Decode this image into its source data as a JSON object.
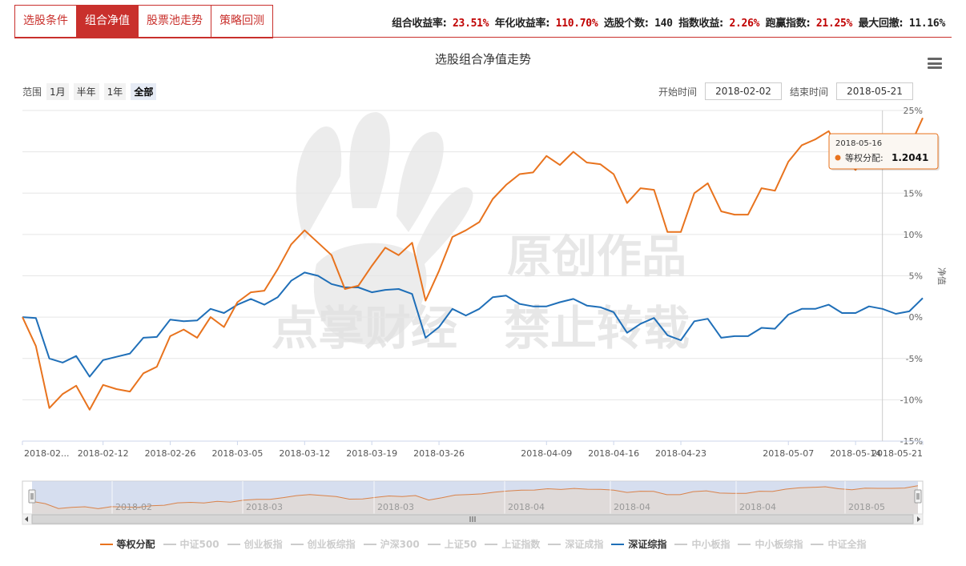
{
  "tabs": [
    {
      "label": "选股条件",
      "active": false
    },
    {
      "label": "组合净值",
      "active": true
    },
    {
      "label": "股票池走势",
      "active": false
    },
    {
      "label": "策略回测",
      "active": false
    }
  ],
  "stats": {
    "combo_return_label": "组合收益率:",
    "combo_return": "23.51%",
    "annual_label": "年化收益率:",
    "annual": "110.70%",
    "count_label": "选股个数:",
    "count": "140",
    "index_return_label": "指数收益:",
    "index_return": "2.26%",
    "beat_label": "跑赢指数:",
    "beat": "21.25%",
    "drawdown_label": "最大回撤:",
    "drawdown": "11.16%"
  },
  "range": {
    "label": "范围",
    "buttons": [
      "1月",
      "半年",
      "1年",
      "全部"
    ],
    "active": "全部"
  },
  "dates": {
    "start_label": "开始时间",
    "start": "2018-02-02",
    "end_label": "结束时间",
    "end": "2018-05-21"
  },
  "tooltip": {
    "date": "2018-05-16",
    "series": "等权分配:",
    "value": "1.2041"
  },
  "watermark": "点掌财经 原创作品 禁止转载",
  "legend": [
    {
      "name": "等权分配",
      "color": "#e8731e",
      "on": true
    },
    {
      "name": "中证500",
      "color": "#cccccc",
      "on": false
    },
    {
      "name": "创业板指",
      "color": "#cccccc",
      "on": false
    },
    {
      "name": "创业板综指",
      "color": "#cccccc",
      "on": false
    },
    {
      "name": "沪深300",
      "color": "#cccccc",
      "on": false
    },
    {
      "name": "上证50",
      "color": "#cccccc",
      "on": false
    },
    {
      "name": "上证指数",
      "color": "#cccccc",
      "on": false
    },
    {
      "name": "深证成指",
      "color": "#cccccc",
      "on": false
    },
    {
      "name": "深证综指",
      "color": "#1f6fb8",
      "on": true
    },
    {
      "name": "中小板指",
      "color": "#cccccc",
      "on": false
    },
    {
      "name": "中小板综指",
      "color": "#cccccc",
      "on": false
    },
    {
      "name": "中证全指",
      "color": "#cccccc",
      "on": false
    }
  ],
  "navigator_labels": [
    "2018-02",
    "2018-03",
    "2018-03",
    "2018-04",
    "2018-04",
    "2018-04",
    "2018-05"
  ],
  "chart_data": {
    "type": "line",
    "title": "选股组合净值走势",
    "ylabel": "净值",
    "ylim": [
      -15,
      25
    ],
    "yticks": [
      "25%",
      "20%",
      "15%",
      "10%",
      "5%",
      "0%",
      "-5%",
      "-10%",
      "-15%"
    ],
    "xticks": [
      "2018-02...",
      "2018-02-12",
      "2018-02-26",
      "2018-03-05",
      "2018-03-12",
      "2018-03-19",
      "2018-03-26",
      "2018-04-09",
      "2018-04-16",
      "2018-04-23",
      "2018-05-07",
      "2018-05-14",
      "2018-05-21"
    ],
    "x": [
      "2018-02-02",
      "2018-02-05",
      "2018-02-06",
      "2018-02-07",
      "2018-02-08",
      "2018-02-09",
      "2018-02-12",
      "2018-02-13",
      "2018-02-14",
      "2018-02-22",
      "2018-02-23",
      "2018-02-26",
      "2018-02-27",
      "2018-02-28",
      "2018-03-01",
      "2018-03-02",
      "2018-03-05",
      "2018-03-06",
      "2018-03-07",
      "2018-03-08",
      "2018-03-09",
      "2018-03-12",
      "2018-03-13",
      "2018-03-14",
      "2018-03-15",
      "2018-03-16",
      "2018-03-19",
      "2018-03-20",
      "2018-03-21",
      "2018-03-22",
      "2018-03-23",
      "2018-03-26",
      "2018-03-27",
      "2018-03-28",
      "2018-03-29",
      "2018-03-30",
      "2018-04-02",
      "2018-04-03",
      "2018-04-04",
      "2018-04-09",
      "2018-04-10",
      "2018-04-11",
      "2018-04-12",
      "2018-04-13",
      "2018-04-16",
      "2018-04-17",
      "2018-04-18",
      "2018-04-19",
      "2018-04-20",
      "2018-04-23",
      "2018-04-24",
      "2018-04-25",
      "2018-04-26",
      "2018-04-27",
      "2018-05-02",
      "2018-05-03",
      "2018-05-04",
      "2018-05-07",
      "2018-05-08",
      "2018-05-09",
      "2018-05-10",
      "2018-05-11",
      "2018-05-14",
      "2018-05-15",
      "2018-05-16",
      "2018-05-17",
      "2018-05-18",
      "2018-05-21"
    ],
    "series": [
      {
        "name": "等权分配",
        "color": "#e8731e",
        "values": [
          0,
          -3.5,
          -11,
          -9.3,
          -8.3,
          -11.2,
          -8.2,
          -8.7,
          -9,
          -6.8,
          -6,
          -2.3,
          -1.5,
          -2.5,
          0,
          -1.2,
          1.8,
          3,
          3.2,
          5.8,
          8.8,
          10.5,
          9,
          7.5,
          3.4,
          3.8,
          6.2,
          8.4,
          7.5,
          9,
          2,
          5.6,
          9.7,
          10.5,
          11.5,
          14.3,
          16,
          17.3,
          17.5,
          19.5,
          18.4,
          20,
          18.7,
          18.5,
          17.3,
          13.8,
          15.6,
          15.4,
          10.3,
          10.3,
          15,
          16.2,
          12.8,
          12.4,
          12.4,
          15.6,
          15.3,
          18.8,
          20.8,
          21.5,
          22.5,
          19.5,
          17.8,
          20.3,
          20.1,
          20.1,
          20.5,
          24.1
        ]
      },
      {
        "name": "深证综指",
        "color": "#1f6fb8",
        "values": [
          0,
          -0.1,
          -5,
          -5.5,
          -4.7,
          -7.2,
          -5.2,
          -4.8,
          -4.4,
          -2.5,
          -2.4,
          -0.3,
          -0.5,
          -0.4,
          1,
          0.5,
          1.5,
          2.2,
          1.5,
          2.4,
          4.4,
          5.4,
          5,
          4,
          3.6,
          3.6,
          3,
          3.3,
          3.4,
          2.8,
          -2.5,
          -1.2,
          1,
          0.2,
          1,
          2.4,
          2.6,
          1.6,
          1.3,
          1.3,
          1.8,
          2.2,
          1.4,
          1.2,
          0.6,
          -1.9,
          -0.8,
          -0.1,
          -2.2,
          -2.8,
          -0.5,
          -0.2,
          -2.5,
          -2.3,
          -2.3,
          -1.3,
          -1.4,
          0.3,
          1,
          1,
          1.5,
          0.5,
          0.5,
          1.3,
          1,
          0.4,
          0.7,
          2.3
        ]
      }
    ],
    "legend_position": "bottom",
    "grid": true
  }
}
